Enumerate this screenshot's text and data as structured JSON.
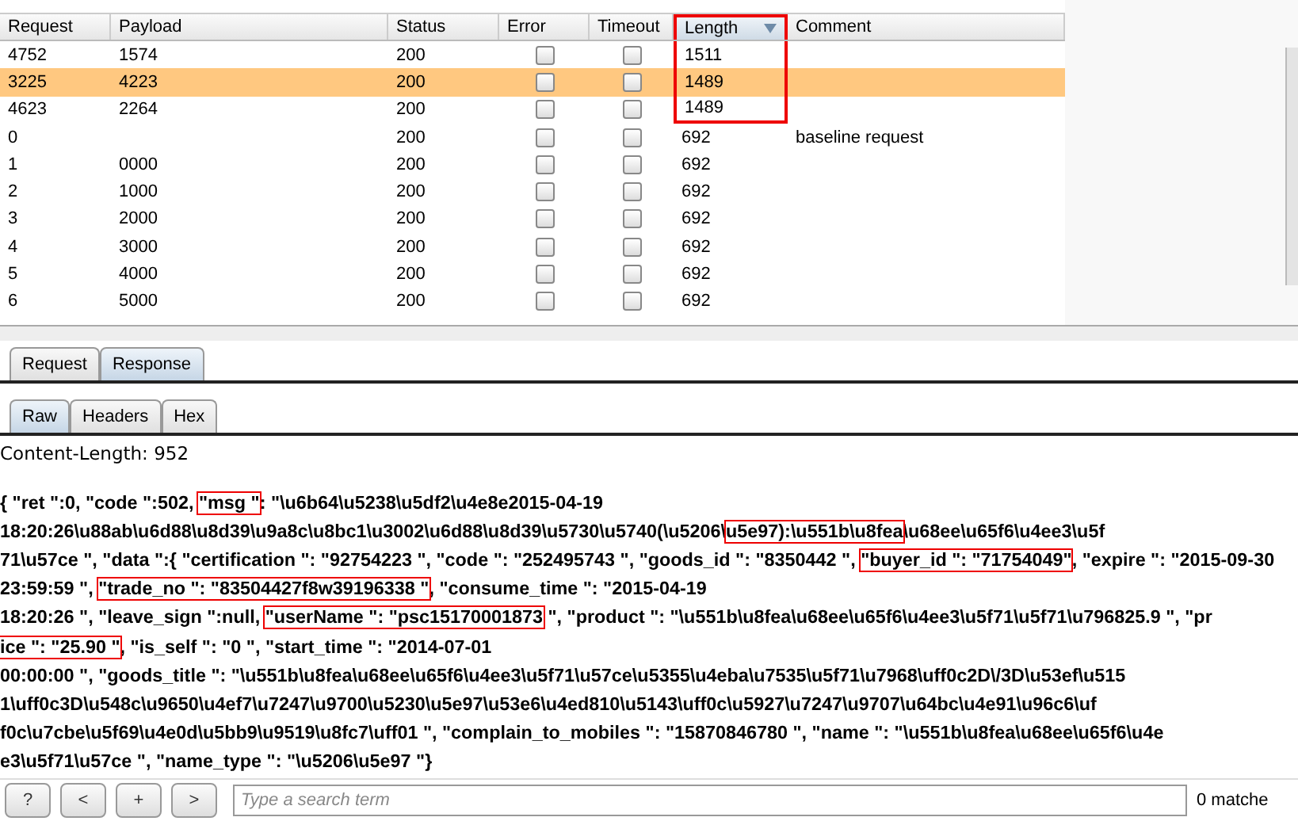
{
  "table": {
    "columns": [
      {
        "label": "Request",
        "boxed": false,
        "sorted": false
      },
      {
        "label": "Payload",
        "boxed": false,
        "sorted": false
      },
      {
        "label": "Status",
        "boxed": false,
        "sorted": false
      },
      {
        "label": "Error",
        "boxed": false,
        "sorted": false
      },
      {
        "label": "Timeout",
        "boxed": false,
        "sorted": false
      },
      {
        "label": "Length",
        "boxed": true,
        "sorted": true
      },
      {
        "label": "Comment",
        "boxed": false,
        "sorted": false
      }
    ],
    "rows": [
      {
        "request": "4752",
        "payload": "1574",
        "status": "200",
        "error": false,
        "timeout": false,
        "length": "1511",
        "length_boxed": true,
        "comment": "",
        "selected": false
      },
      {
        "request": "3225",
        "payload": "4223",
        "status": "200",
        "error": false,
        "timeout": false,
        "length": "1489",
        "length_boxed": true,
        "comment": "",
        "selected": true
      },
      {
        "request": "4623",
        "payload": "2264",
        "status": "200",
        "error": false,
        "timeout": false,
        "length": "1489",
        "length_boxed": true,
        "comment": "",
        "selected": false
      },
      {
        "request": "0",
        "payload": "",
        "status": "200",
        "error": false,
        "timeout": false,
        "length": "692",
        "length_boxed": false,
        "comment": "baseline request",
        "selected": false
      },
      {
        "request": "1",
        "payload": "0000",
        "status": "200",
        "error": false,
        "timeout": false,
        "length": "692",
        "length_boxed": false,
        "comment": "",
        "selected": false
      },
      {
        "request": "2",
        "payload": "1000",
        "status": "200",
        "error": false,
        "timeout": false,
        "length": "692",
        "length_boxed": false,
        "comment": "",
        "selected": false
      },
      {
        "request": "3",
        "payload": "2000",
        "status": "200",
        "error": false,
        "timeout": false,
        "length": "692",
        "length_boxed": false,
        "comment": "",
        "selected": false
      },
      {
        "request": "4",
        "payload": "3000",
        "status": "200",
        "error": false,
        "timeout": false,
        "length": "692",
        "length_boxed": false,
        "comment": "",
        "selected": false
      },
      {
        "request": "5",
        "payload": "4000",
        "status": "200",
        "error": false,
        "timeout": false,
        "length": "692",
        "length_boxed": false,
        "comment": "",
        "selected": false
      },
      {
        "request": "6",
        "payload": "5000",
        "status": "200",
        "error": false,
        "timeout": false,
        "length": "692",
        "length_boxed": false,
        "comment": "",
        "selected": false
      }
    ]
  },
  "message_tabs": [
    {
      "label": "Request",
      "selected": false
    },
    {
      "label": "Response",
      "selected": true
    }
  ],
  "view_tabs": [
    {
      "label": "Raw",
      "selected": true
    },
    {
      "label": "Headers",
      "selected": false
    },
    {
      "label": "Hex",
      "selected": false
    }
  ],
  "header_line": "Content-Length: 952",
  "body_lines": [
    [
      {
        "text": "{ \"ret \":0, \"code \":502, ",
        "boxed": false
      },
      {
        "text": "\"msg \"",
        "boxed": true
      },
      {
        "text": ": \"\\u6b64\\u5238\\u5df2\\u4e8e2015-04-19",
        "boxed": false
      }
    ],
    [
      {
        "text": "18:20:26\\u88ab\\u6d88\\u8d39\\u9a8c\\u8bc1\\u3002\\u6d88\\u8d39\\u5730\\u5740(\\u5206\\",
        "boxed": false
      },
      {
        "text": "u5e97):\\u551b\\u8fea",
        "boxed": true
      },
      {
        "text": "\\u68ee\\u65f6\\u4ee3\\u5f",
        "boxed": false
      }
    ],
    [
      {
        "text": "71\\u57ce \", \"data \":{ \"certification \": \"92754223 \", \"code \": \"252495743 \", \"goods_id \": \"8350442 \", ",
        "boxed": false
      },
      {
        "text": "\"buyer_id \": \"71754049\"",
        "boxed": true
      },
      {
        "text": ", \"expire \": \"2015-09-30",
        "boxed": false
      }
    ],
    [
      {
        "text": "23:59:59 \", ",
        "boxed": false
      },
      {
        "text": "\"trade_no \": \"83504427f8w39196338 \"",
        "boxed": true
      },
      {
        "text": ", \"consume_time \": \"2015-04-19",
        "boxed": false
      }
    ],
    [
      {
        "text": "18:20:26 \", \"leave_sign \":null, ",
        "boxed": false
      },
      {
        "text": "\"userName \": \"psc15170001873",
        "boxed": true
      },
      {
        "text": " \", \"product \": \"\\u551b\\u8fea\\u68ee\\u65f6\\u4ee3\\u5f71\\u5f71\\u796825.9 \", \"pr",
        "boxed": false
      }
    ],
    [
      {
        "text": "ice \": \"25.90 \"",
        "boxed": true
      },
      {
        "text": ", \"is_self \": \"0 \", \"start_time \": \"2014-07-01",
        "boxed": false
      }
    ],
    [
      {
        "text": "00:00:00 \", \"goods_title \": \"\\u551b\\u8fea\\u68ee\\u65f6\\u4ee3\\u5f71\\u57ce\\u5355\\u4eba\\u7535\\u5f71\\u7968\\uff0c2D\\/3D\\u53ef\\u515",
        "boxed": false
      }
    ],
    [
      {
        "text": "1\\uff0c3D\\u548c\\u9650\\u4ef7\\u7247\\u9700\\u5230\\u5e97\\u53e6\\u4ed810\\u5143\\uff0c\\u5927\\u7247\\u9707\\u64bc\\u4e91\\u96c6\\uf",
        "boxed": false
      }
    ],
    [
      {
        "text": "f0c\\u7cbe\\u5f69\\u4e0d\\u5bb9\\u9519\\u8fc7\\uff01 \", \"complain_to_mobiles \": \"15870846780 \", \"name \": \"\\u551b\\u8fea\\u68ee\\u65f6\\u4e",
        "boxed": false
      }
    ],
    [
      {
        "text": "e3\\u5f71\\u57ce \", \"name_type \": \"\\u5206\\u5e97 \"}",
        "boxed": false
      }
    ]
  ],
  "search_bar": {
    "buttons": [
      "?",
      "<",
      "+",
      ">"
    ],
    "placeholder": "Type a search term",
    "matches": "0 matche"
  }
}
